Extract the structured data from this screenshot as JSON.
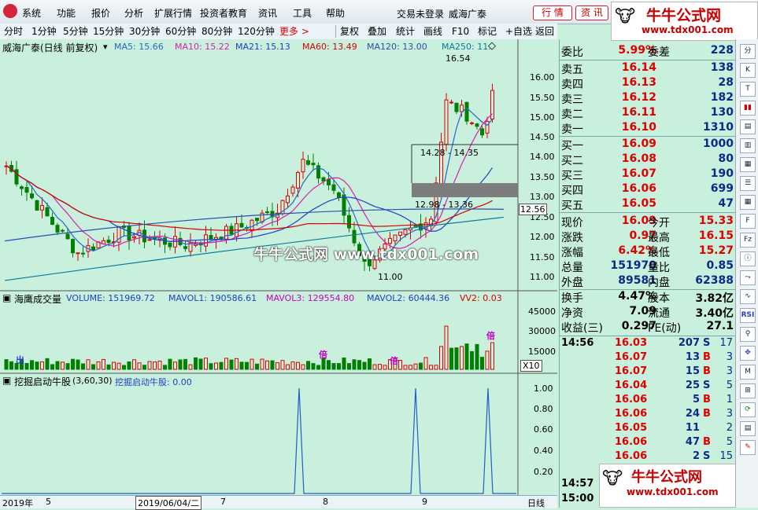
{
  "menu": {
    "items": [
      "系统",
      "功能",
      "报价",
      "分析",
      "扩展行情",
      "投资者教育",
      "资讯",
      "工具",
      "帮助"
    ],
    "login": "交易未登录",
    "stock": "威海广泰",
    "tab_quote": "行 情",
    "tab_info": "资 讯"
  },
  "toolbar": {
    "periods": [
      "分时",
      "1分钟",
      "5分钟",
      "15分钟",
      "30分钟",
      "60分钟",
      "80分钟",
      "120分钟"
    ],
    "more": "更多 >",
    "right": [
      "复权",
      "叠加",
      "统计",
      "画线",
      "F10",
      "标记",
      "+自选",
      "返回"
    ]
  },
  "main_chart": {
    "title": "威海广泰(日线 前复权)",
    "ma": [
      {
        "label": "MA5: 15.66",
        "color": "#2a66c8"
      },
      {
        "label": "MA10: 15.22",
        "color": "#d81fb0"
      },
      {
        "label": "MA21: 15.13",
        "color": "#1f3fc8"
      },
      {
        "label": "MA60: 13.49",
        "color": "#d40000"
      },
      {
        "label": "MA120: 13.00",
        "color": "#2b4fb0"
      },
      {
        "label": "MA250: 11.",
        "color": "#0a7a9a"
      }
    ],
    "y_ticks": [
      "16.00",
      "15.50",
      "15.00",
      "14.50",
      "14.00",
      "13.50",
      "13.00",
      "12.50",
      "12.00",
      "11.50",
      "11.00"
    ],
    "current_price": "12.56",
    "annotations": {
      "high": "16.54",
      "low": "11.00",
      "band_hi": "14.28 - 14.35",
      "band_lo": "12.98 - 13.36"
    }
  },
  "volume_panel": {
    "title": "海鹰成交量",
    "items": [
      {
        "label": "VOLUME: 151969.72",
        "color": "#1f3fc8"
      },
      {
        "label": "MAVOL1: 190586.61",
        "color": "#1f3fc8"
      },
      {
        "label": "MAVOL3: 129554.80",
        "color": "#c800c8"
      },
      {
        "label": "MAVOL2: 60444.36",
        "color": "#1f3fc8"
      },
      {
        "label": "VV2: 0.03",
        "color": "#d40000"
      }
    ],
    "y_ticks": [
      "45000",
      "30000",
      "15000"
    ],
    "unit": "X10",
    "tags": {
      "chu": "出",
      "bei": "倍"
    }
  },
  "signal_panel": {
    "title": "挖掘启动牛股",
    "params": "(3,60,30)",
    "value": "挖掘启动牛股: 0.00",
    "y_ticks": [
      "1.00",
      "0.80",
      "0.60",
      "0.40",
      "0.20"
    ],
    "spikes": [
      380,
      528,
      620
    ]
  },
  "bottom": {
    "year": "2019年",
    "month5": "5",
    "date": "2019/06/04/二",
    "month7": "7",
    "month8": "8",
    "month9": "9",
    "period": "日线"
  },
  "quote": {
    "weibi_label": "委比",
    "weibi": "5.99%",
    "weicha_label": "委差",
    "weicha": "228",
    "sell": [
      {
        "k": "卖五",
        "p": "16.14",
        "n": "138"
      },
      {
        "k": "卖四",
        "p": "16.13",
        "n": "28"
      },
      {
        "k": "卖三",
        "p": "16.12",
        "n": "182"
      },
      {
        "k": "卖二",
        "p": "16.11",
        "n": "130"
      },
      {
        "k": "卖一",
        "p": "16.10",
        "n": "1310"
      }
    ],
    "buy": [
      {
        "k": "买一",
        "p": "16.09",
        "n": "1000"
      },
      {
        "k": "买二",
        "p": "16.08",
        "n": "80"
      },
      {
        "k": "买三",
        "p": "16.07",
        "n": "190"
      },
      {
        "k": "买四",
        "p": "16.06",
        "n": "699"
      },
      {
        "k": "买五",
        "p": "16.05",
        "n": "47"
      }
    ],
    "stats": [
      {
        "k1": "现价",
        "v1": "16.09",
        "k2": "今开",
        "v2": "15.33"
      },
      {
        "k1": "涨跌",
        "v1": "0.97",
        "k2": "最高",
        "v2": "16.15"
      },
      {
        "k1": "涨幅",
        "v1": "6.42%",
        "k2": "最低",
        "v2": "15.27"
      },
      {
        "k1": "总量",
        "v1": "151970",
        "k2": "量比",
        "v2": "0.85"
      },
      {
        "k1": "外盘",
        "v1": "89581",
        "k2": "内盘",
        "v2": "62388"
      }
    ],
    "stats2": [
      {
        "k1": "换手",
        "v1": "4.47%",
        "k2": "股本",
        "v2": "3.82亿"
      },
      {
        "k1": "净资",
        "v1": "7.09",
        "k2": "流通",
        "v2": "3.40亿"
      },
      {
        "k1": "收益(三)",
        "v1": "0.297",
        "k2": "PE(动)",
        "v2": "27.1"
      }
    ],
    "ticks": [
      {
        "t": "14:56",
        "p": "16.03",
        "v": "207",
        "bs": "S",
        "c": "17"
      },
      {
        "t": "",
        "p": "16.07",
        "v": "13",
        "bs": "B",
        "c": "3"
      },
      {
        "t": "",
        "p": "16.07",
        "v": "15",
        "bs": "B",
        "c": "3"
      },
      {
        "t": "",
        "p": "16.04",
        "v": "25",
        "bs": "S",
        "c": "5"
      },
      {
        "t": "",
        "p": "16.06",
        "v": "5",
        "bs": "B",
        "c": "1"
      },
      {
        "t": "",
        "p": "16.06",
        "v": "24",
        "bs": "B",
        "c": "3"
      },
      {
        "t": "",
        "p": "16.05",
        "v": "11",
        "bs": "",
        "c": "2"
      },
      {
        "t": "",
        "p": "16.06",
        "v": "47",
        "bs": "B",
        "c": "5"
      },
      {
        "t": "",
        "p": "16.06",
        "v": "2",
        "bs": "S",
        "c": "15"
      }
    ],
    "time1": "14:57",
    "time2": "15:00"
  },
  "watermark": {
    "brand": "牛牛公式网",
    "url": "www.tdx001.com",
    "center": "牛牛公式网 www.tdx001.com"
  },
  "sidebar_icons": [
    "分",
    "K",
    "T",
    "F",
    "Fz",
    "RSI",
    "M"
  ]
}
